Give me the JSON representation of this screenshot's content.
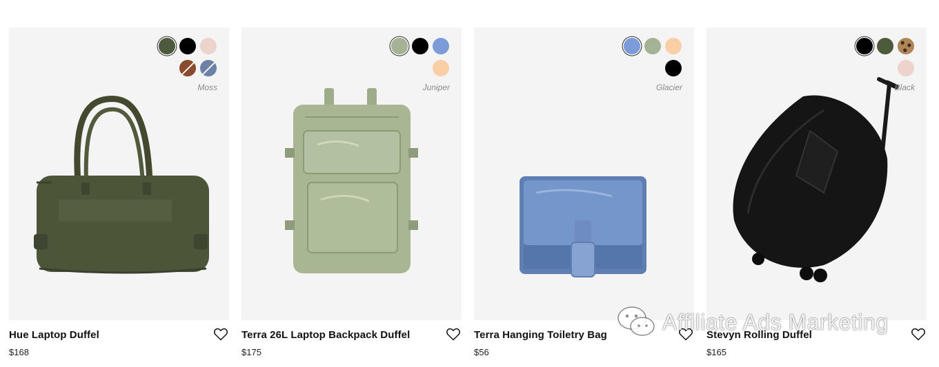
{
  "products": [
    {
      "name": "Hue Laptop Duffel",
      "price": "$168",
      "color_label": "Moss",
      "swatches": [
        {
          "color": "#4e5a3c",
          "selected": true
        },
        {
          "color": "#000000"
        },
        {
          "color": "#ecd3cc"
        },
        {
          "color": "#8a4a2c",
          "striped": true
        },
        {
          "color": "#6b82a6",
          "striped": true
        }
      ],
      "wishlist_icon": "heart-icon"
    },
    {
      "name": "Terra 26L Laptop Backpack Duffel",
      "price": "$175",
      "color_label": "Juniper",
      "swatches": [
        {
          "color": "#a6b294",
          "selected": true
        },
        {
          "color": "#000000"
        },
        {
          "color": "#7d9bd9"
        },
        {
          "color": "#fbcfa6"
        }
      ],
      "wishlist_icon": "heart-icon"
    },
    {
      "name": "Terra Hanging Toiletry Bag",
      "price": "$56",
      "color_label": "Glacier",
      "swatches": [
        {
          "color": "#7d9bd9",
          "selected": true
        },
        {
          "color": "#a6b294"
        },
        {
          "color": "#fbcfa6"
        },
        {
          "color": "#000000"
        }
      ],
      "wishlist_icon": "heart-icon"
    },
    {
      "name": "Stevyn Rolling Duffel",
      "price": "$165",
      "color_label": "Black",
      "swatches": [
        {
          "color": "#000000",
          "selected": true
        },
        {
          "color": "#4e5a3c"
        },
        {
          "color": "#b08558",
          "pattern": "leopard"
        },
        {
          "color": "#ecd3cc"
        }
      ],
      "wishlist_icon": "heart-icon"
    }
  ],
  "watermark": {
    "text": "Affiliate Ads Marketing",
    "icon": "wechat-icon"
  }
}
